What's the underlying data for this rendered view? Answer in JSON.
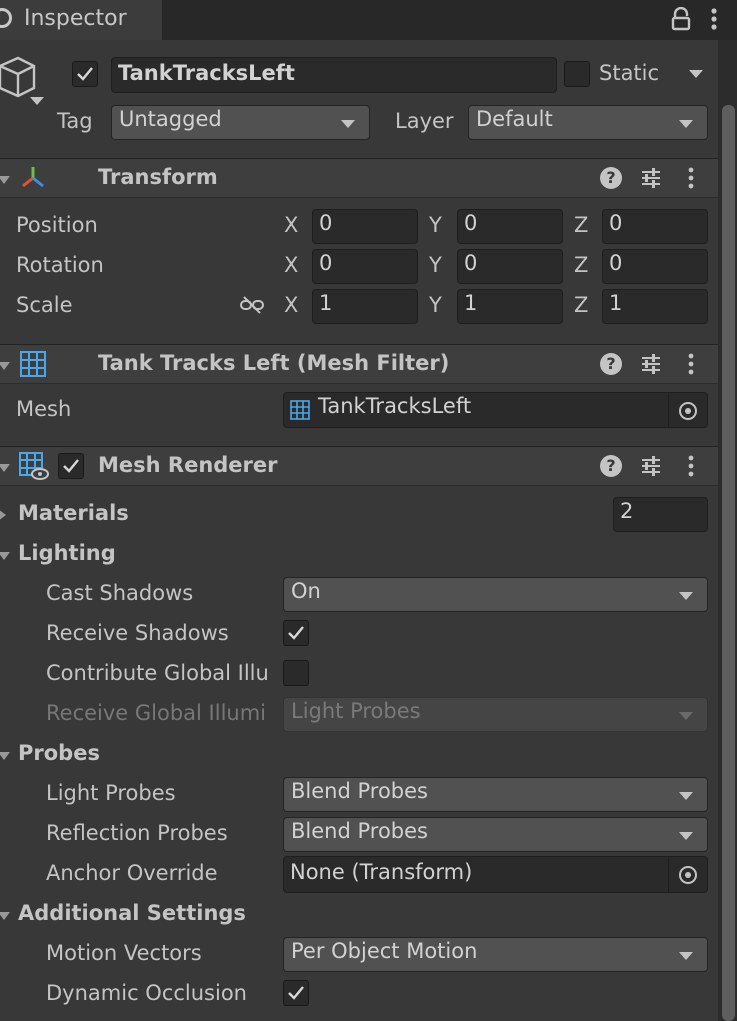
{
  "tab": {
    "title": "Inspector"
  },
  "header": {
    "object_name": "TankTracksLeft",
    "static_label": "Static",
    "tag_label": "Tag",
    "tag_value": "Untagged",
    "layer_label": "Layer",
    "layer_value": "Default"
  },
  "transform": {
    "title": "Transform",
    "position": {
      "label": "Position",
      "x": "0",
      "y": "0",
      "z": "0"
    },
    "rotation": {
      "label": "Rotation",
      "x": "0",
      "y": "0",
      "z": "0"
    },
    "scale": {
      "label": "Scale",
      "x": "1",
      "y": "1",
      "z": "1"
    },
    "axis_x": "X",
    "axis_y": "Y",
    "axis_z": "Z"
  },
  "mesh_filter": {
    "title": "Tank Tracks Left (Mesh Filter)",
    "mesh_label": "Mesh",
    "mesh_value": "TankTracksLeft"
  },
  "mesh_renderer": {
    "title": "Mesh Renderer",
    "materials_label": "Materials",
    "materials_count": "2",
    "lighting_label": "Lighting",
    "cast_shadows_label": "Cast Shadows",
    "cast_shadows_value": "On",
    "receive_shadows_label": "Receive Shadows",
    "contribute_gi_label": "Contribute Global Illu",
    "receive_gi_label": "Receive Global Illumi",
    "receive_gi_value": "Light Probes",
    "probes_label": "Probes",
    "light_probes_label": "Light Probes",
    "light_probes_value": "Blend Probes",
    "reflection_probes_label": "Reflection Probes",
    "reflection_probes_value": "Blend Probes",
    "anchor_override_label": "Anchor Override",
    "anchor_override_value": "None (Transform)",
    "additional_label": "Additional Settings",
    "motion_vectors_label": "Motion Vectors",
    "motion_vectors_value": "Per Object Motion",
    "dynamic_occlusion_label": "Dynamic Occlusion"
  },
  "states": {
    "active_checked": true,
    "static_checked": false,
    "renderer_enabled": true,
    "receive_shadows": true,
    "contribute_gi": false,
    "dynamic_occlusion": true
  }
}
